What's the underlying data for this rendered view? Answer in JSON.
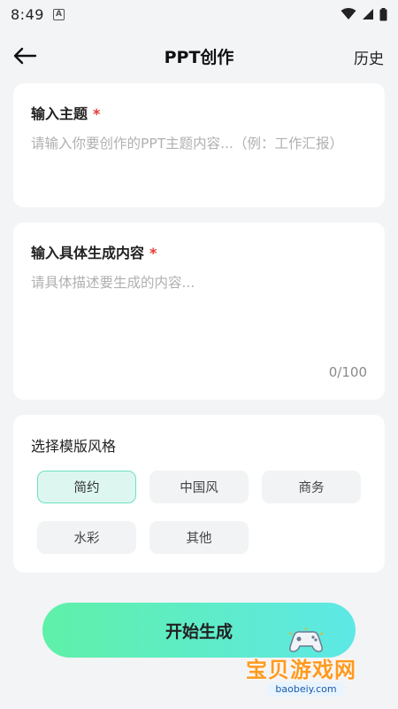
{
  "status_bar": {
    "time": "8:49",
    "notification_icon": "A"
  },
  "header": {
    "title": "PPT创作",
    "history_label": "历史"
  },
  "topic_field": {
    "label": "输入主题",
    "required_mark": "*",
    "placeholder": "请输入你要创作的PPT主题内容...（例：工作汇报）"
  },
  "content_field": {
    "label": "输入具体生成内容",
    "required_mark": "*",
    "placeholder": "请具体描述要生成的内容...",
    "counter": "0/100"
  },
  "template_style": {
    "label": "选择模版风格",
    "options": [
      "简约",
      "中国风",
      "商务",
      "水彩",
      "其他"
    ],
    "selected": "简约"
  },
  "generate_button": {
    "label": "开始生成"
  },
  "watermark": {
    "title": "宝贝游戏网",
    "url": "baobeiy.com"
  },
  "colors": {
    "accent_start": "#5ff0a8",
    "accent_end": "#5ee8e6",
    "required": "#e53935",
    "selected_chip_bg": "#ddf7f0",
    "selected_chip_border": "#6fe0c4"
  }
}
